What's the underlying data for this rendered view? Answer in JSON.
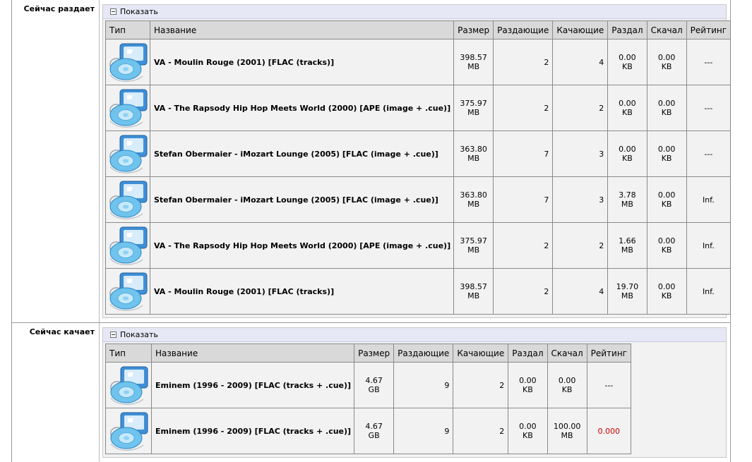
{
  "sections": [
    {
      "label": "Сейчас раздает",
      "toggle_label": "Показать",
      "headers": [
        "Тип",
        "Название",
        "Размер",
        "Раздающие",
        "Качающие",
        "Раздал",
        "Скачал",
        "Рейтинг"
      ],
      "rows": [
        {
          "type_icon": "ipod-music-icon",
          "name": "VA - Moulin Rouge (2001) [FLAC (tracks)]",
          "size": [
            "398.57",
            "MB"
          ],
          "seeders": "2",
          "leechers": "4",
          "uploaded": [
            "0.00",
            "KB"
          ],
          "downloaded": [
            "0.00",
            "KB"
          ],
          "rating": "---",
          "rating_color": "#000000"
        },
        {
          "type_icon": "ipod-music-icon",
          "name": "VA - The Rapsody Hip Hop Meets World (2000) [APE (image + .cue)]",
          "size": [
            "375.97",
            "MB"
          ],
          "seeders": "2",
          "leechers": "2",
          "uploaded": [
            "0.00",
            "KB"
          ],
          "downloaded": [
            "0.00",
            "KB"
          ],
          "rating": "---",
          "rating_color": "#000000"
        },
        {
          "type_icon": "ipod-music-icon",
          "name": "Stefan Obermaier - iMozart Lounge (2005) [FLAC (image + .cue)]",
          "size": [
            "363.80",
            "MB"
          ],
          "seeders": "7",
          "leechers": "3",
          "uploaded": [
            "0.00",
            "KB"
          ],
          "downloaded": [
            "0.00",
            "KB"
          ],
          "rating": "---",
          "rating_color": "#000000"
        },
        {
          "type_icon": "ipod-music-icon",
          "name": "Stefan Obermaier - iMozart Lounge (2005) [FLAC (image + .cue)]",
          "size": [
            "363.80",
            "MB"
          ],
          "seeders": "7",
          "leechers": "3",
          "uploaded": [
            "3.78",
            "MB"
          ],
          "downloaded": [
            "0.00",
            "KB"
          ],
          "rating": "Inf.",
          "rating_color": "#000000"
        },
        {
          "type_icon": "ipod-music-icon",
          "name": "VA - The Rapsody Hip Hop Meets World (2000) [APE (image + .cue)]",
          "size": [
            "375.97",
            "MB"
          ],
          "seeders": "2",
          "leechers": "2",
          "uploaded": [
            "1.66",
            "MB"
          ],
          "downloaded": [
            "0.00",
            "KB"
          ],
          "rating": "Inf.",
          "rating_color": "#000000"
        },
        {
          "type_icon": "ipod-music-icon",
          "name": "VA - Moulin Rouge (2001) [FLAC (tracks)]",
          "size": [
            "398.57",
            "MB"
          ],
          "seeders": "2",
          "leechers": "4",
          "uploaded": [
            "19.70",
            "MB"
          ],
          "downloaded": [
            "0.00",
            "KB"
          ],
          "rating": "Inf.",
          "rating_color": "#000000"
        }
      ]
    },
    {
      "label": "Сейчас качает",
      "toggle_label": "Показать",
      "headers": [
        "Тип",
        "Название",
        "Размер",
        "Раздающие",
        "Качающие",
        "Раздал",
        "Скачал",
        "Рейтинг"
      ],
      "rows": [
        {
          "type_icon": "ipod-music-icon",
          "name": "Eminem (1996 - 2009) [FLAC (tracks + .cue)]",
          "size": [
            "4.67",
            "GB"
          ],
          "seeders": "9",
          "leechers": "2",
          "uploaded": [
            "0.00",
            "KB"
          ],
          "downloaded": [
            "0.00",
            "KB"
          ],
          "rating": "---",
          "rating_color": "#000000"
        },
        {
          "type_icon": "ipod-music-icon",
          "name": "Eminem (1996 - 2009) [FLAC (tracks + .cue)]",
          "size": [
            "4.67",
            "GB"
          ],
          "seeders": "9",
          "leechers": "2",
          "uploaded": [
            "0.00",
            "KB"
          ],
          "downloaded": [
            "100.00",
            "MB"
          ],
          "rating": "0.000",
          "rating_color": "#cc0000"
        }
      ]
    }
  ]
}
